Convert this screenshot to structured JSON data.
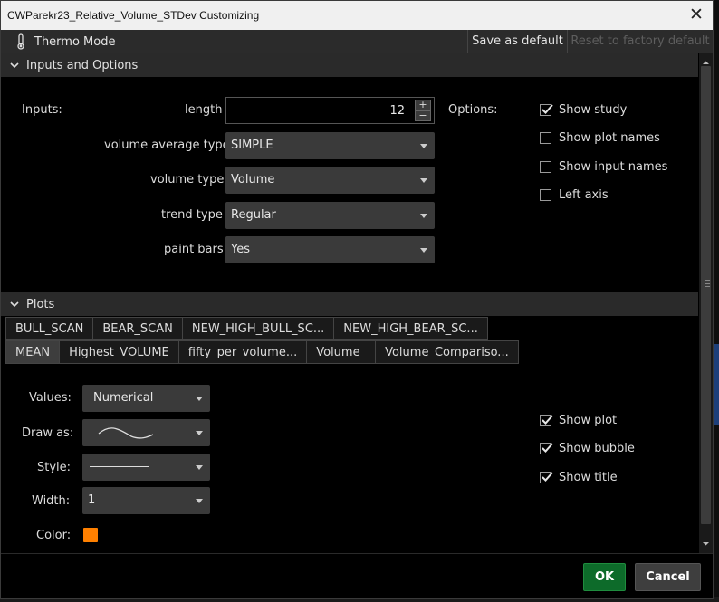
{
  "window": {
    "title": "CWParekr23_Relative_Volume_STDev Customizing"
  },
  "toolbar": {
    "thermo_label": "Thermo Mode",
    "save_default_label": "Save as default",
    "reset_factory_label": "Reset to factory default"
  },
  "inputs_section": {
    "header": "Inputs and Options",
    "inputs_label": "Inputs:",
    "options_label": "Options:",
    "length": {
      "label": "length",
      "value": "12"
    },
    "volume_average_type": {
      "label": "volume average type",
      "value": "SIMPLE"
    },
    "volume_type": {
      "label": "volume type",
      "value": "Volume"
    },
    "trend_type": {
      "label": "trend type",
      "value": "Regular"
    },
    "paint_bars": {
      "label": "paint bars",
      "value": "Yes"
    },
    "options": [
      {
        "label": "Show study",
        "checked": true
      },
      {
        "label": "Show plot names",
        "checked": false
      },
      {
        "label": "Show input names",
        "checked": false
      },
      {
        "label": "Left axis",
        "checked": false
      }
    ]
  },
  "plots_section": {
    "header": "Plots",
    "tabs_row1": [
      "BULL_SCAN",
      "BEAR_SCAN",
      "NEW_HIGH_BULL_SC...",
      "NEW_HIGH_BEAR_SC..."
    ],
    "tabs_row2": [
      "MEAN",
      "Highest_VOLUME",
      "fifty_per_volume...",
      "Volume_",
      "Volume_Compariso..."
    ],
    "active_tab": "MEAN",
    "values_label": "Values:",
    "values_value": "Numerical",
    "draw_as_label": "Draw as:",
    "style_label": "Style:",
    "width_label": "Width:",
    "width_value": "1",
    "color_label": "Color:",
    "color": "#ff8000",
    "plot_options": [
      {
        "label": "Show plot",
        "checked": true
      },
      {
        "label": "Show bubble",
        "checked": true
      },
      {
        "label": "Show title",
        "checked": true
      }
    ]
  },
  "footer": {
    "ok_label": "OK",
    "cancel_label": "Cancel"
  }
}
